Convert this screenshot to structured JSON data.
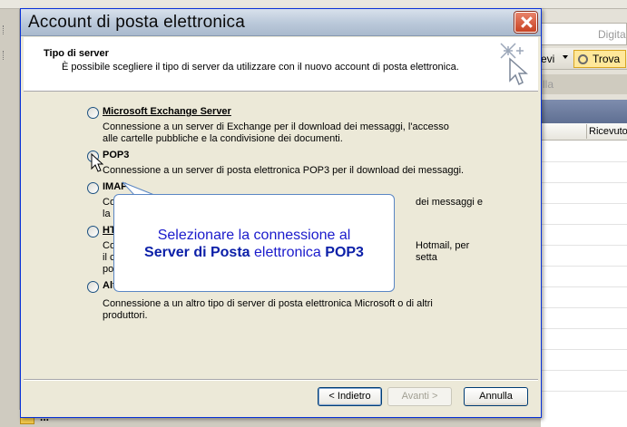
{
  "background": {
    "search_placeholder": "Digita",
    "toolbar_partial": "evi",
    "find_button": "Trova",
    "filter_partial": "lla",
    "column_header": "Ricevuto",
    "bottom_partial": "..."
  },
  "dialog": {
    "title": "Account di posta elettronica",
    "header_title": "Tipo di server",
    "header_subtitle": "È possibile scegliere il tipo di server da utilizzare con il nuovo account di posta elettronica.",
    "options": [
      {
        "label": "Microsoft Exchange Server",
        "description": "Connessione a un server di Exchange per il download dei messaggi, l'accesso alle cartelle pubbliche e la condivisione dei documenti."
      },
      {
        "label": "POP3",
        "description": "Connessione a un server di posta elettronica POP3 per il download dei messaggi."
      },
      {
        "label": "IMAP",
        "description_visible_right": "dei messaggi e",
        "description_visible_left": "Co",
        "description_visible_left2": "la"
      },
      {
        "label": "HT",
        "description_visible_right": "Hotmail, per",
        "description_visible_right2": "setta",
        "description_visible_left": "Co",
        "description_visible_left2": "il c",
        "description_visible_left3": "po"
      },
      {
        "label": "Alt",
        "description": "Connessione a un altro tipo di server di posta elettronica Microsoft o di altri produttori."
      }
    ],
    "buttons": {
      "back": "< Indietro",
      "next": "Avanti >",
      "cancel": "Annulla"
    }
  },
  "callout": {
    "line1": "Selezionare la connessione al",
    "line2_bold1": "Server di Posta",
    "line2_normal": " elettronica ",
    "line2_bold2": "POP3"
  },
  "colors": {
    "callout_text": "#1b1bcc",
    "callout_border": "#5a86c4",
    "dialog_bg": "#ece9d8",
    "close_button": "#c84323"
  }
}
